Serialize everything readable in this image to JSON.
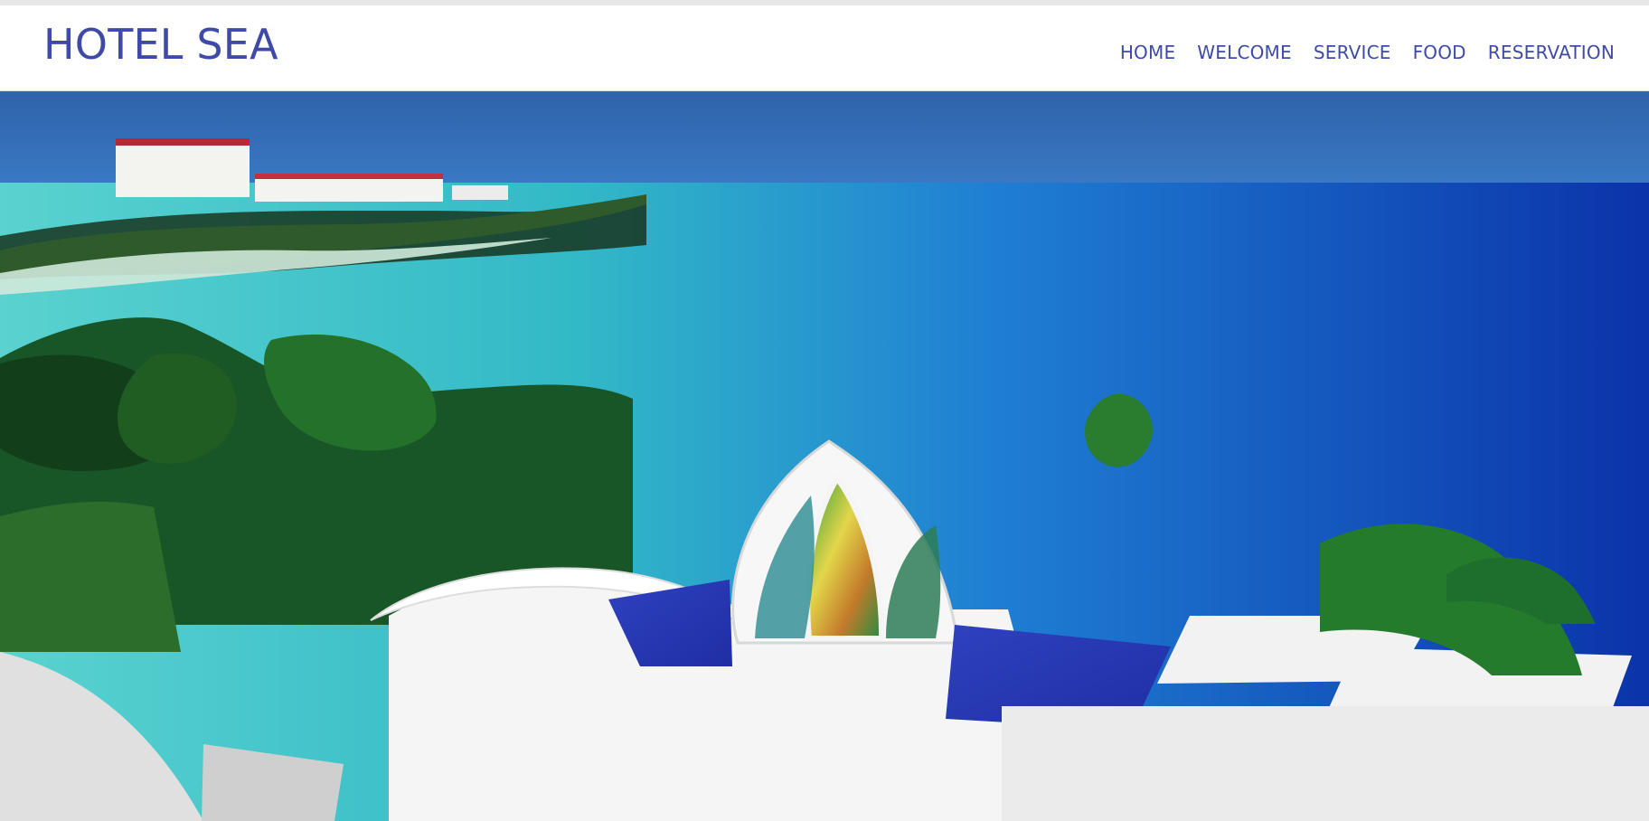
{
  "brand": {
    "title": "HOTEL SEA"
  },
  "nav": {
    "items": [
      {
        "label": "HOME"
      },
      {
        "label": "WELCOME"
      },
      {
        "label": "SERVICE"
      },
      {
        "label": "FOOD"
      },
      {
        "label": "RESERVATION"
      }
    ]
  },
  "hero": {
    "icon": "seaside-hotel-photo"
  }
}
